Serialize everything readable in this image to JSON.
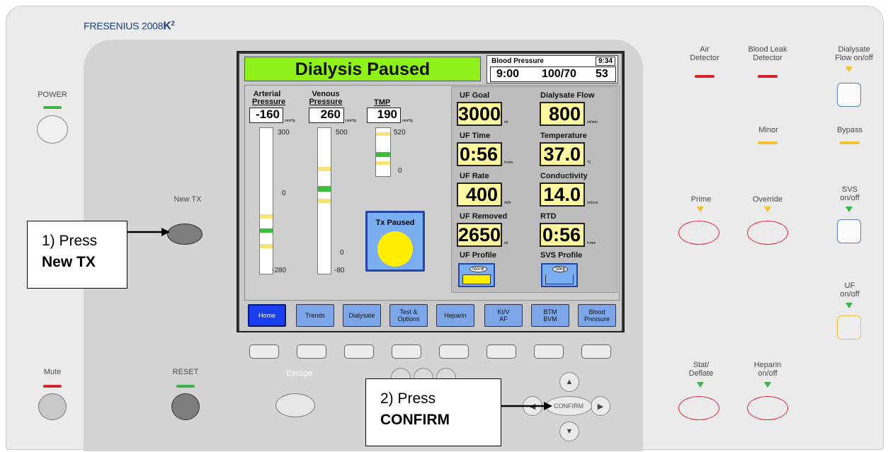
{
  "brand": {
    "name": "FRESENIUS 2008",
    "model": "K",
    "model_sup": "2"
  },
  "left": {
    "power": "POWER",
    "newtx": "New TX",
    "mute": "Mute",
    "reset": "RESET",
    "escape": "Escape"
  },
  "screen": {
    "status": "Dialysis Paused",
    "bp": {
      "title": "Blood Pressure",
      "clock": "9:34",
      "time": "9:00",
      "reading": "100/70",
      "pulse": "53"
    },
    "arterial": {
      "label1": "Arterial",
      "label2": "Pressure",
      "value": "-160",
      "unit": "mmHg",
      "top": "300",
      "mid": "0",
      "bottom": "-280"
    },
    "venous": {
      "label1": "Venous",
      "label2": "Pressure",
      "value": "260",
      "unit": "mmHg",
      "top": "500",
      "mid": "0",
      "bottom": "-80"
    },
    "tmp": {
      "label": "TMP",
      "value": "190",
      "unit": "mmHg",
      "top": "520",
      "bottom": "0"
    },
    "tx_paused": "Tx Paused",
    "uf_goal": {
      "label": "UF Goal",
      "value": "3000",
      "unit": "ml"
    },
    "uf_time": {
      "label": "UF Time",
      "value": "0:56",
      "unit": "h:min"
    },
    "uf_rate": {
      "label": "UF Rate",
      "value": "400",
      "unit": "ml/h"
    },
    "uf_removed": {
      "label": "UF Removed",
      "value": "2650",
      "unit": "ml"
    },
    "uf_profile": {
      "label": "UF Profile",
      "badge": "None"
    },
    "dialysate_flow": {
      "label": "Dialysate Flow",
      "value": "800",
      "unit": "ml/min"
    },
    "temperature": {
      "label": "Temperature",
      "value": "37.0",
      "unit": "°C"
    },
    "conductivity": {
      "label": "Conductivity",
      "value": "14.0",
      "unit": "mS/cm"
    },
    "rtd": {
      "label": "RTD",
      "value": "0:56",
      "unit": "h:min"
    },
    "svs_profile": {
      "label": "SVS Profile",
      "badge": "Step"
    },
    "tabs": [
      {
        "label1": "Home",
        "label2": ""
      },
      {
        "label1": "Trends",
        "label2": ""
      },
      {
        "label1": "Dialysate",
        "label2": ""
      },
      {
        "label1": "Test &",
        "label2": "Options"
      },
      {
        "label1": "Heparin",
        "label2": ""
      },
      {
        "label1": "Kt/V",
        "label2": "AF"
      },
      {
        "label1": "BTM",
        "label2": "BVM"
      },
      {
        "label1": "Blood",
        "label2": "Pressure"
      }
    ]
  },
  "right": {
    "air": "Air\nDetector",
    "bloodleak": "Blood Leak\nDetector",
    "dialysate_flow": "Dialysate\nFlow on/off",
    "minor": "Minor",
    "bypass": "Bypass",
    "prime": "Prime",
    "override": "Override",
    "svs": "SVS\non/off",
    "uf": "UF\non/off",
    "stat": "Stat/\nDeflate",
    "heparin": "Heparin\non/off"
  },
  "nav": {
    "confirm": "CONFIRM"
  },
  "callouts": {
    "one_a": "1) Press",
    "one_b": "New TX",
    "two_a": "2) Press",
    "two_b": "CONFIRM"
  },
  "colors": {
    "status_green": "#8ef21a",
    "value_yellow": "#fff8a0",
    "tab_blue": "#7ca6e8",
    "tab_active": "#1a3ff0",
    "led_red": "#d3252b",
    "led_green": "#3bb34a",
    "led_yellow": "#f2c230"
  }
}
